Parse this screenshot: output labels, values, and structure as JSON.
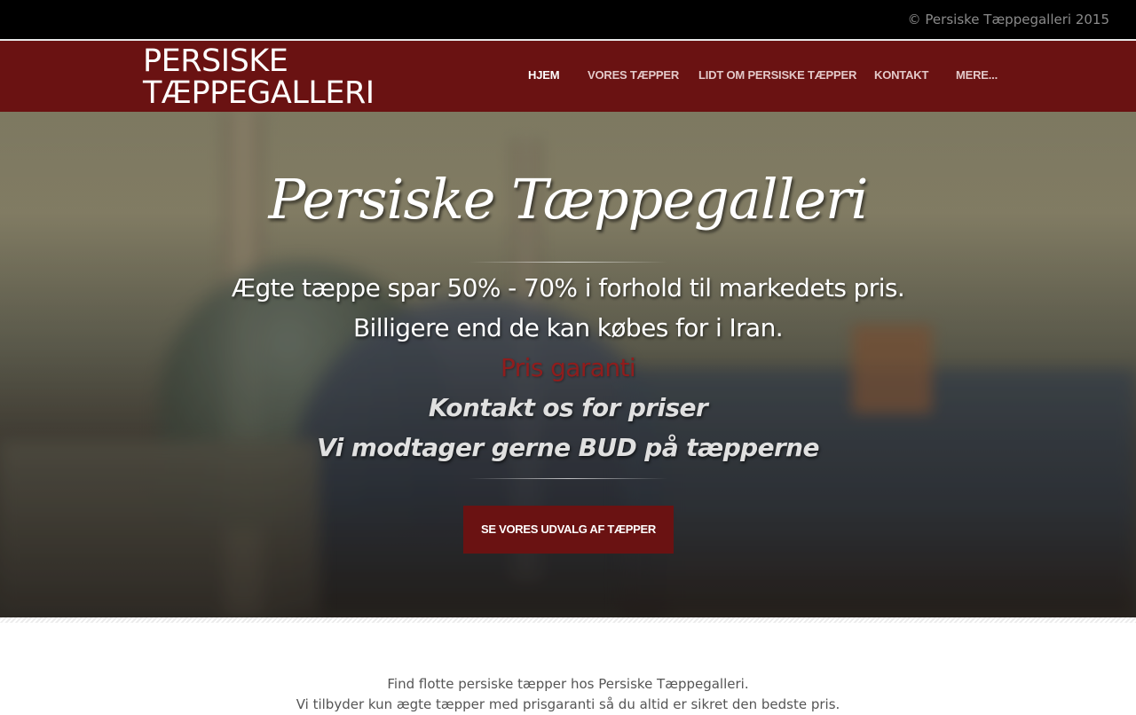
{
  "topbar": {
    "copyright": "© Persiske Tæppegalleri 2015"
  },
  "header": {
    "logo_line1": "PERSISKE",
    "logo_line2": "TÆPPEGALLERI",
    "nav": [
      {
        "label": "HJEM",
        "active": true
      },
      {
        "label": "VORES TÆPPER",
        "active": false
      },
      {
        "label": "LIDT OM PERSISKE TÆPPER",
        "active": false
      },
      {
        "label": "KONTAKT",
        "active": false
      },
      {
        "label": "MERE...",
        "active": false
      }
    ]
  },
  "hero": {
    "title": "Persiske Tæppegalleri",
    "lines": [
      "Ægte tæppe spar 50% - 70% i forhold til markedets pris.",
      "Billigere end de kan købes for i Iran.",
      "Pris garanti",
      "Kontakt os for priser",
      "Vi modtager gerne BUD på tæpperne"
    ],
    "cta_label": "SE VORES UDVALG AF TÆPPER"
  },
  "intro": {
    "line1": "Find flotte persiske tæpper hos Persiske Tæppegalleri.",
    "line2": "Vi tilbyder kun ægte tæpper med prisgaranti så du altid er sikret den bedste pris."
  },
  "colors": {
    "brand": "#6a1212",
    "accent_text": "#8f1d1d",
    "topbar": "#000000"
  }
}
